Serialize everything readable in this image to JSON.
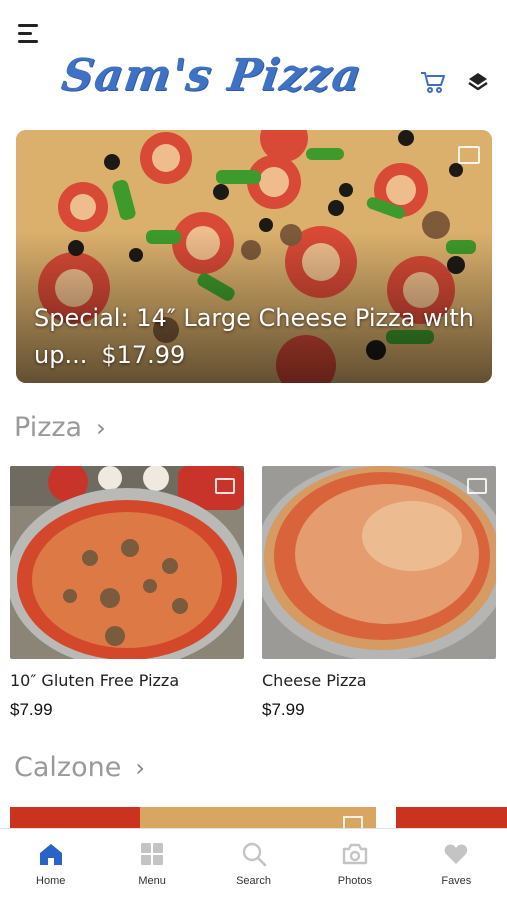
{
  "header": {
    "logo_text": "Sam's Pizza",
    "icons": [
      "menu-icon",
      "cart-icon",
      "layers-icon"
    ]
  },
  "hero": {
    "title": "Special: 14″ Large Cheese Pizza with up...",
    "price": "$17.99",
    "icon": "image-icon"
  },
  "sections": [
    {
      "title": "Pizza",
      "items": [
        {
          "name": "10″ Gluten Free Pizza",
          "price": "$7.99",
          "icon": "image-icon"
        },
        {
          "name": "Cheese Pizza",
          "price": "$7.99",
          "icon": "image-icon"
        }
      ]
    },
    {
      "title": "Calzone",
      "items": []
    }
  ],
  "tabbar": {
    "tabs": [
      {
        "label": "Home",
        "icon": "home-icon",
        "active": true
      },
      {
        "label": "Menu",
        "icon": "grid-icon",
        "active": false
      },
      {
        "label": "Search",
        "icon": "search-icon",
        "active": false
      },
      {
        "label": "Photos",
        "icon": "camera-icon",
        "active": false
      },
      {
        "label": "Faves",
        "icon": "heart-icon",
        "active": false
      }
    ]
  },
  "colors": {
    "brand": "#3f72c4",
    "active_tab": "#2a63c7",
    "inactive_tab": "#c4c4c4",
    "section_title": "#9a9a9a"
  }
}
